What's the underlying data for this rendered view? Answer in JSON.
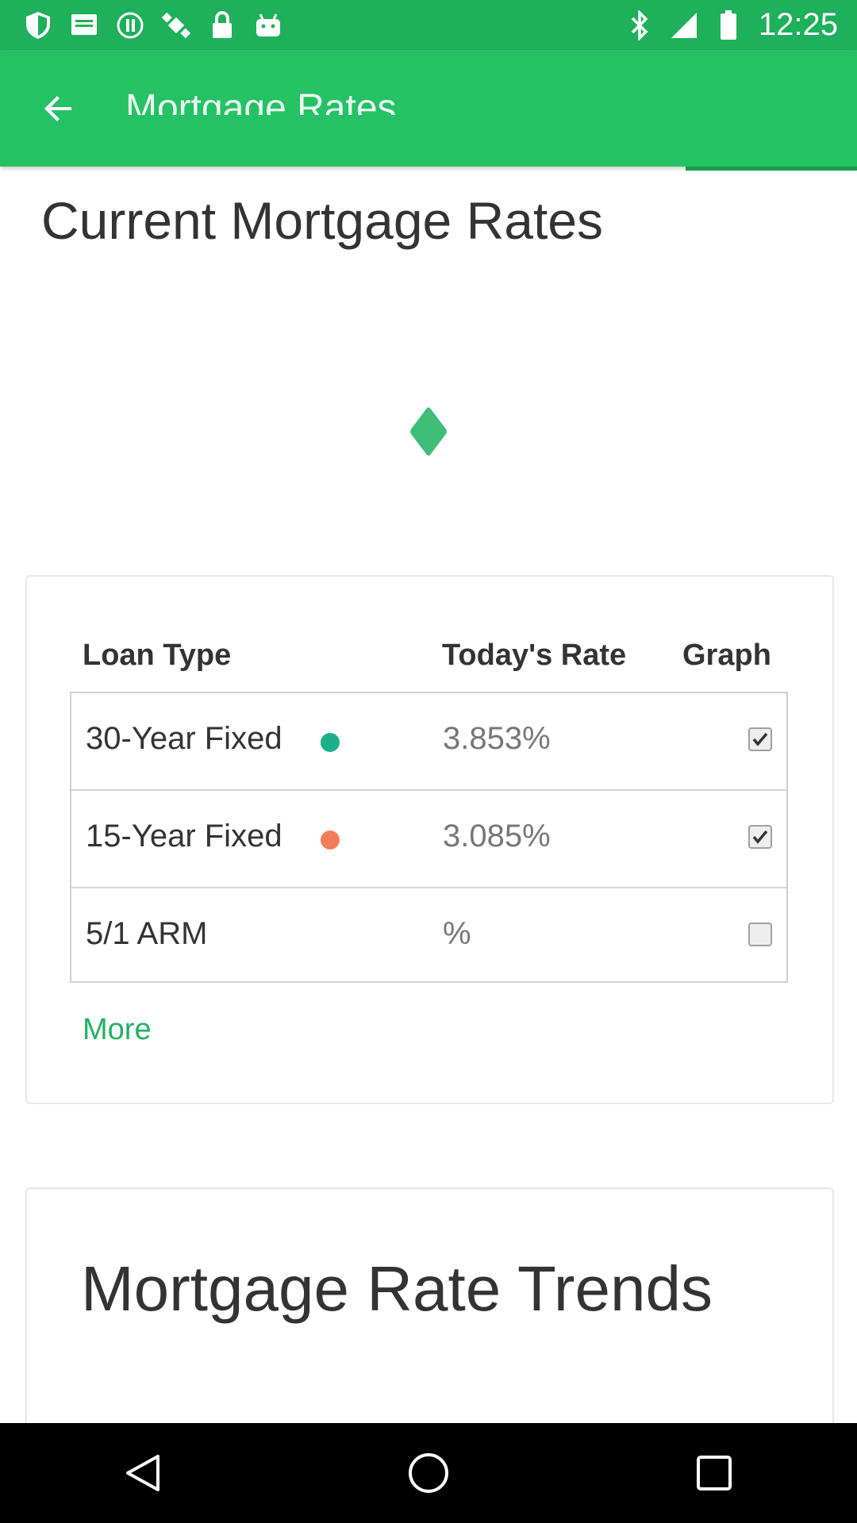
{
  "status_bar": {
    "time": "12:25",
    "icons": [
      "shield-icon",
      "message-icon",
      "hotspot-icon",
      "fake-gps-icon",
      "lock-icon",
      "android-icon",
      "bluetooth-icon",
      "signal-icon",
      "battery-icon"
    ],
    "color": "#1fb05b"
  },
  "app_bar": {
    "title": "Mortgage Rates",
    "back_icon": "arrow-back-icon",
    "color": "#24c265"
  },
  "page": {
    "title": "Current Mortgage Rates"
  },
  "rates_table": {
    "headers": {
      "loan_type": "Loan Type",
      "todays_rate": "Today's Rate",
      "graph": "Graph"
    },
    "rows": [
      {
        "loan_type": "30-Year Fixed",
        "rate": "3.853%",
        "dot_color": "#1bb08a",
        "graph_checked": true
      },
      {
        "loan_type": "15-Year Fixed",
        "rate": "3.085%",
        "dot_color": "#f47c5c",
        "graph_checked": true
      },
      {
        "loan_type": "5/1 ARM",
        "rate": "%",
        "dot_color": null,
        "graph_checked": false
      }
    ],
    "more_label": "More",
    "accent": "#24b063"
  },
  "trends": {
    "title": "Mortgage Rate Trends"
  },
  "nav_bar": {
    "buttons": [
      "back-triangle-icon",
      "home-circle-icon",
      "recents-square-icon"
    ]
  }
}
